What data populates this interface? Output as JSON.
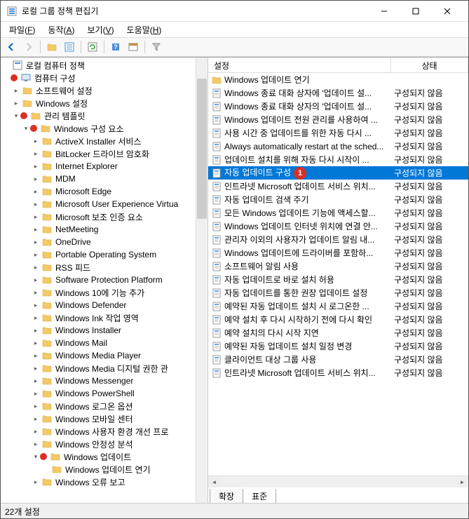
{
  "window": {
    "title": "로컬 그룹 정책 편집기"
  },
  "menu": {
    "file": "파일(F)",
    "action": "동작(A)",
    "view": "보기(V)",
    "help": "도움말(H)"
  },
  "tree": {
    "root": "로컬 컴퓨터 정책",
    "computer_config": "컴퓨터 구성",
    "software_settings": "소프트웨어 설정",
    "windows_settings": "Windows 설정",
    "admin_templates": "관리 템플릿",
    "windows_components": "Windows 구성 요소",
    "items": [
      "ActiveX Installer 서비스",
      "BitLocker 드라이브 암호화",
      "Internet Explorer",
      "MDM",
      "Microsoft Edge",
      "Microsoft User Experience Virtua",
      "Microsoft 보조 인증 요소",
      "NetMeeting",
      "OneDrive",
      "Portable Operating System",
      "RSS 피드",
      "Software Protection Platform",
      "Windows 10에 기능 추가",
      "Windows Defender",
      "Windows Ink 작업 영역",
      "Windows Installer",
      "Windows Mail",
      "Windows Media Player",
      "Windows Media 디지털 권한 관",
      "Windows Messenger",
      "Windows PowerShell",
      "Windows 로그온 옵션",
      "Windows 모바일 센터",
      "Windows 사용자 환경 개선 프로",
      "Windows 안정성 분석"
    ],
    "windows_update": "Windows 업데이트",
    "windows_update_defer": "Windows 업데이트 연기",
    "windows_error": "Windows 오류 보고"
  },
  "list": {
    "header_setting": "설정",
    "header_status": "상태",
    "status_not_configured": "구성되지 않음",
    "rows": [
      {
        "name": "Windows 업데이트 연기",
        "type": "folder",
        "status": ""
      },
      {
        "name": "Windows 종료 대화 상자에 '업데이트 설...",
        "type": "setting",
        "status": "구성되지 않음"
      },
      {
        "name": "Windows 종료 대화 상자의 '업데이트 설...",
        "type": "setting",
        "status": "구성되지 않음"
      },
      {
        "name": "Windows 업데이트 전원 관리를 사용하여 ...",
        "type": "setting",
        "status": "구성되지 않음"
      },
      {
        "name": "사용 시간 중 업데이트를 위한 자동 다시 ...",
        "type": "setting",
        "status": "구성되지 않음"
      },
      {
        "name": "Always automatically restart at the sched...",
        "type": "setting",
        "status": "구성되지 않음"
      },
      {
        "name": "업데이트 설치를 위해 자동 다시 시작이 ...",
        "type": "setting",
        "status": "구성되지 않음"
      },
      {
        "name": "자동 업데이트 구성",
        "type": "setting",
        "status": "구성되지 않음",
        "selected": true,
        "badge": "1"
      },
      {
        "name": "인트라넷 Microsoft 업데이트 서비스 위치...",
        "type": "setting",
        "status": "구성되지 않음"
      },
      {
        "name": "자동 업데이트 검색 주기",
        "type": "setting",
        "status": "구성되지 않음"
      },
      {
        "name": "모든 Windows 업데이트 기능에 액세스할...",
        "type": "setting",
        "status": "구성되지 않음"
      },
      {
        "name": "Windows 업데이트 인터넷 위치에 연결 안...",
        "type": "setting",
        "status": "구성되지 않음"
      },
      {
        "name": "관리자 이외의 사용자가 업데이트 알림 내...",
        "type": "setting",
        "status": "구성되지 않음"
      },
      {
        "name": "Windows 업데이트에 드라이버를 포함하...",
        "type": "setting",
        "status": "구성되지 않음"
      },
      {
        "name": "소프트웨어 알림 사용",
        "type": "setting",
        "status": "구성되지 않음"
      },
      {
        "name": "자동 업데이트로 바로 설치 허용",
        "type": "setting",
        "status": "구성되지 않음"
      },
      {
        "name": "자동 업데이트를 통한 권장 업데이트 설정",
        "type": "setting",
        "status": "구성되지 않음"
      },
      {
        "name": "예약된 자동 업데이트 설치 시 로그온한 ...",
        "type": "setting",
        "status": "구성되지 않음"
      },
      {
        "name": "예약 설치 후 다시 시작하기 전에 다시 확인",
        "type": "setting",
        "status": "구성되지 않음"
      },
      {
        "name": "예약 설치의 다시 시작 지연",
        "type": "setting",
        "status": "구성되지 않음"
      },
      {
        "name": "예약된 자동 업데이트 설치 일정 변경",
        "type": "setting",
        "status": "구성되지 않음"
      },
      {
        "name": "클라이언트 대상 그룹 사용",
        "type": "setting",
        "status": "구성되지 않음"
      },
      {
        "name": "인트라넷 Microsoft 업데이트 서비스 위치...",
        "type": "setting",
        "status": "구성되지 않음"
      }
    ]
  },
  "tabs": {
    "extended": "확장",
    "standard": "표준"
  },
  "statusbar": {
    "text": "22개 설정"
  }
}
